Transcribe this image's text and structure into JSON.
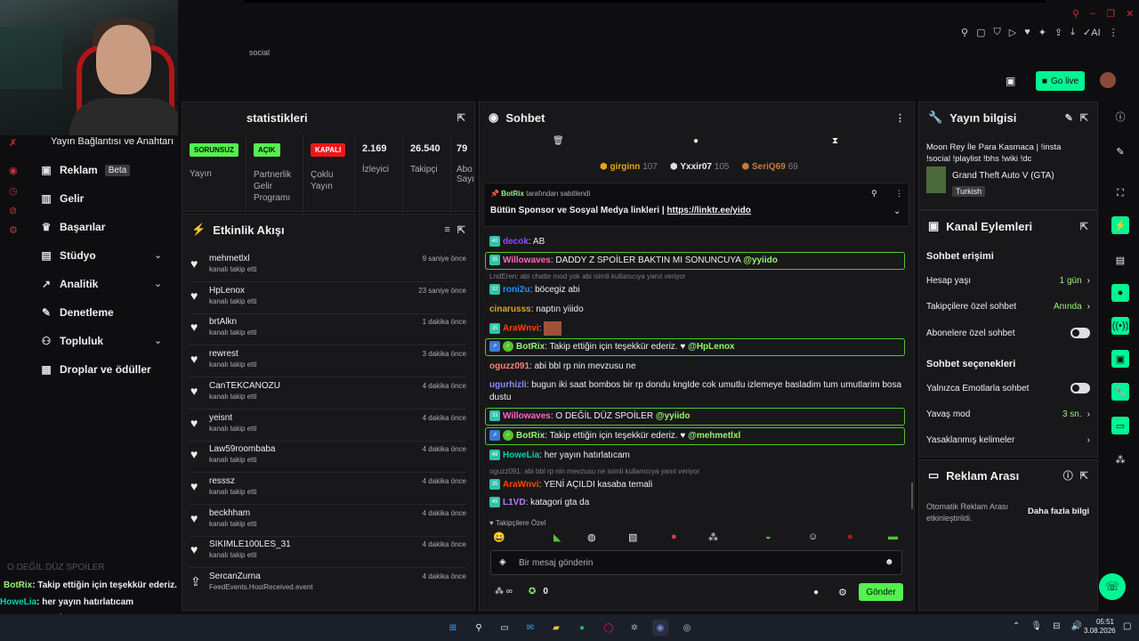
{
  "topbar": {
    "social_label": "social",
    "go_live": "Go live"
  },
  "top_icons": [
    "pin-icon",
    "square-icon",
    "shield-icon",
    "play-icon",
    "heart-icon",
    "puzzle-icon",
    "share-icon",
    "download-icon",
    "ai-icon",
    "menu-icon"
  ],
  "ai_label": "AI",
  "left_nav": {
    "connection": "Yayın Bağlantısı ve Anahtarı",
    "items": [
      {
        "label": "Reklam",
        "badge": "Beta"
      },
      {
        "label": "Gelir"
      },
      {
        "label": "Başarılar"
      },
      {
        "label": "Stüdyo"
      },
      {
        "label": "Analitik"
      },
      {
        "label": "Denetleme"
      },
      {
        "label": "Topluluk"
      },
      {
        "label": "Droplar ve ödüller"
      }
    ]
  },
  "stats": {
    "title": "statistikleri",
    "boxes": [
      {
        "pill": "SORUNSUZ",
        "label": "Yayın"
      },
      {
        "pill": "AÇIK",
        "label": "Partnerlik Gelir Programı"
      },
      {
        "pill": "KAPALI",
        "label": "Çoklu Yayın"
      },
      {
        "value": "2.169",
        "label": "İzleyici"
      },
      {
        "value": "26.540",
        "label": "Takipçi"
      },
      {
        "value": "79",
        "label": "Abo Sayı"
      }
    ]
  },
  "activity": {
    "title": "Etkinlik Akışı",
    "rows": [
      {
        "name": "mehmetlxl",
        "sub": "kanalı takip etti",
        "time": "9 saniye önce"
      },
      {
        "name": "HpLenox",
        "sub": "kanalı takip etti",
        "time": "23 saniye önce"
      },
      {
        "name": "brtAlkn",
        "sub": "kanalı takip etti",
        "time": "1 dakika önce"
      },
      {
        "name": "rewrest",
        "sub": "kanalı takip etti",
        "time": "3 dakika önce"
      },
      {
        "name": "CanTEKCANOZU",
        "sub": "kanalı takip etti",
        "time": "4 dakika önce"
      },
      {
        "name": "yeisnt",
        "sub": "kanalı takip etti",
        "time": "4 dakika önce"
      },
      {
        "name": "Law59roombaba",
        "sub": "kanalı takip etti",
        "time": "4 dakika önce"
      },
      {
        "name": "resssz",
        "sub": "kanalı takip etti",
        "time": "4 dakika önce"
      },
      {
        "name": "beckhham",
        "sub": "kanalı takip etti",
        "time": "4 dakika önce"
      },
      {
        "name": "SIKIMLE100LES_31",
        "sub": "kanalı takip etti",
        "time": "4 dakika önce"
      },
      {
        "name": "SercanZurna",
        "sub": "FeedEvents.HostReceived.event",
        "time": "4 dakika önce"
      }
    ]
  },
  "chat": {
    "title": "Sohbet",
    "leaders": [
      {
        "name": "girginn",
        "count": "107",
        "color": "#e8a317"
      },
      {
        "name": "Yxxir07",
        "count": "105",
        "color": "#dedee3"
      },
      {
        "name": "SeriQ69",
        "count": "69",
        "color": "#c87941"
      }
    ],
    "pinned_by": "BotRix",
    "pinned_suffix": "tarafından sabitlendi",
    "pinned_text": "Bütün Sponsor ve Sosyal Medya linkleri |",
    "pinned_link": "https://linktr.ee/yido",
    "messages": [
      {
        "badge": "40",
        "user": "decok",
        "color": "#9147ff",
        "text": "AB"
      },
      {
        "badge": "35",
        "user": "Willowaves",
        "color": "#ff69b4",
        "text": "DADDY Z SPOİLER BAKTIN MI SONUNCUYA",
        "mention": "@yyiido",
        "hl": true
      },
      {
        "reply": "LndEren: abi chatte mod yok abi isimli kullanıcıya yanıt veriyor"
      },
      {
        "badge": "32",
        "user": "roni2u",
        "color": "#1e90ff",
        "text": "böcegiz abi"
      },
      {
        "user": "cinarusss",
        "color": "#daa520",
        "text": "naptın yiiido"
      },
      {
        "badge": "35",
        "user": "AraWnvi",
        "color": "#ff4500",
        "text": ""
      },
      {
        "user": "BotRix",
        "color": "#9bf274",
        "text": "Takip ettiğin için teşekkür ederiz. ♥",
        "mention": "@HpLenox",
        "hl": true
      },
      {
        "user": "oguzz091",
        "color": "#ff7f7f",
        "text": "abi bbl rp nin mevzusu ne"
      },
      {
        "user": "ugurhizli",
        "color": "#8a8aff",
        "text": "bugun iki saat bombos bir rp dondu kngIde cok umutlu izlemeye basladim tum umutlarim bosa dustu"
      },
      {
        "badge": "33",
        "user": "Willowaves",
        "color": "#ff69b4",
        "text": "O DEĞİL DÜZ SPOİLER",
        "mention": "@yyiido",
        "hl": true
      },
      {
        "user": "BotRix",
        "color": "#9bf274",
        "text": "Takip ettiğin için teşekkür ederiz. ♥",
        "mention": "@mehmetlxl",
        "hl": true
      },
      {
        "badge": "49",
        "user": "HoweLia",
        "color": "#00d4aa",
        "text": "her yayın hatırlatıcam"
      },
      {
        "reply": "oguzz091: abi bbl rp nin mevzusu ne isimli kullanıcıya yanıt veriyor"
      },
      {
        "badge": "35",
        "user": "AraWnvi",
        "color": "#ff4500",
        "text": "YENİ AÇILDI kasaba temali"
      },
      {
        "badge": "49",
        "user": "L1VD",
        "color": "#b57bff",
        "text": "katagori gta da"
      }
    ],
    "followers_only": "Takipçilere Özel",
    "input_placeholder": "Bir mesaj gönderin",
    "points": "0",
    "send": "Gönder"
  },
  "stream_info": {
    "title": "Yayın bilgisi",
    "stream_title": "Moon Rey İle Para Kasmaca | !insta !social !playlist !bhs !wiki !dc",
    "game": "Grand Theft Auto V (GTA)",
    "language": "Turkish"
  },
  "channel_actions": {
    "title": "Kanal Eylemleri",
    "chat_access": "Sohbet erişimi",
    "rows1": [
      {
        "label": "Hesap yaşı",
        "value": "1 gün"
      },
      {
        "label": "Takipçilere özel sohbet",
        "value": "Anında"
      },
      {
        "label": "Abonelere özel sohbet",
        "toggle": true
      }
    ],
    "chat_options": "Sohbet seçenekleri",
    "rows2": [
      {
        "label": "Yalnızca Emotlarla sohbet",
        "toggle": true
      },
      {
        "label": "Yavaş mod",
        "value": "3 sn."
      },
      {
        "label": "Yasaklanmış kelimeler",
        "value": ""
      }
    ]
  },
  "ad_break": {
    "title": "Reklam Arası",
    "text": "Otomatik Reklam Arası etkinleştirildi.",
    "link": "Daha fazla bilgi"
  },
  "overlay_chat": [
    {
      "user": "BotRix",
      "color": "#9bf274",
      "text": ": Takip ettiğin için teşekkür ederiz."
    },
    {
      "user": "HoweLia",
      "color": "#00d4aa",
      "text": ": her yayın hatırlatıcam"
    },
    {
      "user": "AraWnvi",
      "color": "#ff4500",
      "text": ": YENİ AÇILDI kasaba temali"
    },
    {
      "user": "L1VD",
      "color": "#b57bff",
      "text": ": katagori gta da"
    }
  ],
  "overlay_faded": "O DEĞİL DÜZ SPOİLER",
  "clock": {
    "time": "05:51",
    "date": "3.08.2026"
  }
}
